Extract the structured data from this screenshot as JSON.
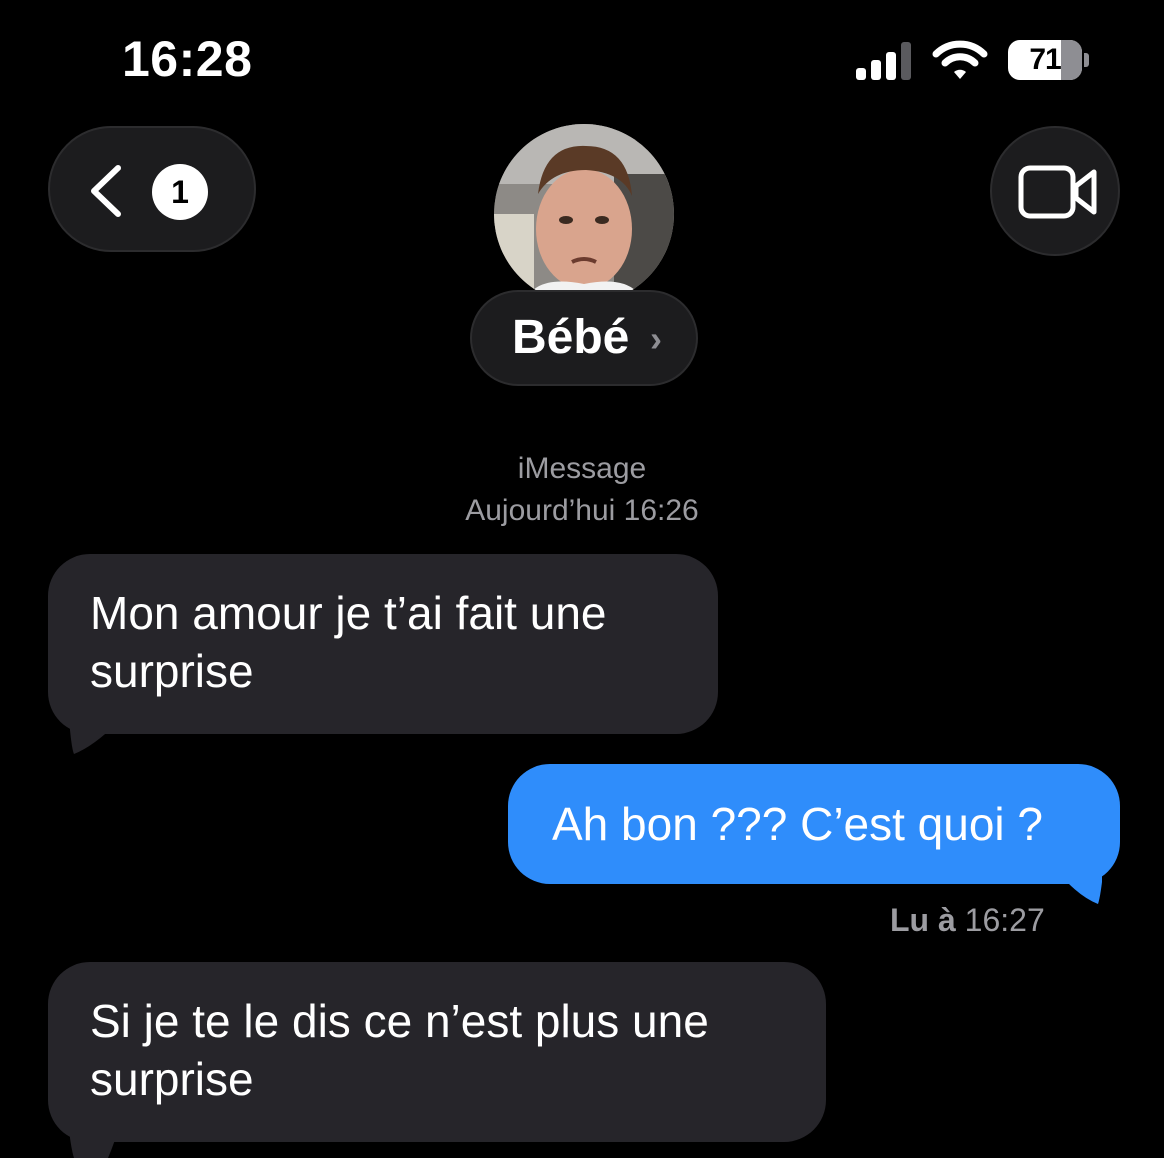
{
  "status_bar": {
    "time": "16:28",
    "battery_level": "71",
    "battery_percent": 71,
    "signal_bars_active": 3,
    "signal_bars_total": 4
  },
  "nav": {
    "unread_count": "1",
    "contact_name": "Bébé",
    "contact_chevron": "›"
  },
  "conversation": {
    "service_label": "iMessage",
    "date_label": "Aujourd’hui 16:26",
    "messages": [
      {
        "direction": "incoming",
        "text": "Mon amour je t’ai fait une surprise"
      },
      {
        "direction": "outgoing",
        "text": "Ah bon ??? C’est quoi ?"
      },
      {
        "direction": "incoming",
        "text": "Si je te le dis ce n’est plus une surprise"
      }
    ],
    "read_receipt": {
      "prefix": "Lu à",
      "time": "16:27"
    }
  },
  "colors": {
    "background": "#000000",
    "incoming_bubble": "#26252a",
    "outgoing_bubble": "#2f8dfb",
    "secondary_text": "#9c9ca1"
  },
  "icons": {
    "back": "chevron-left-icon",
    "video": "video-camera-icon",
    "signal": "cellular-signal-icon",
    "wifi": "wifi-icon",
    "battery": "battery-icon"
  }
}
